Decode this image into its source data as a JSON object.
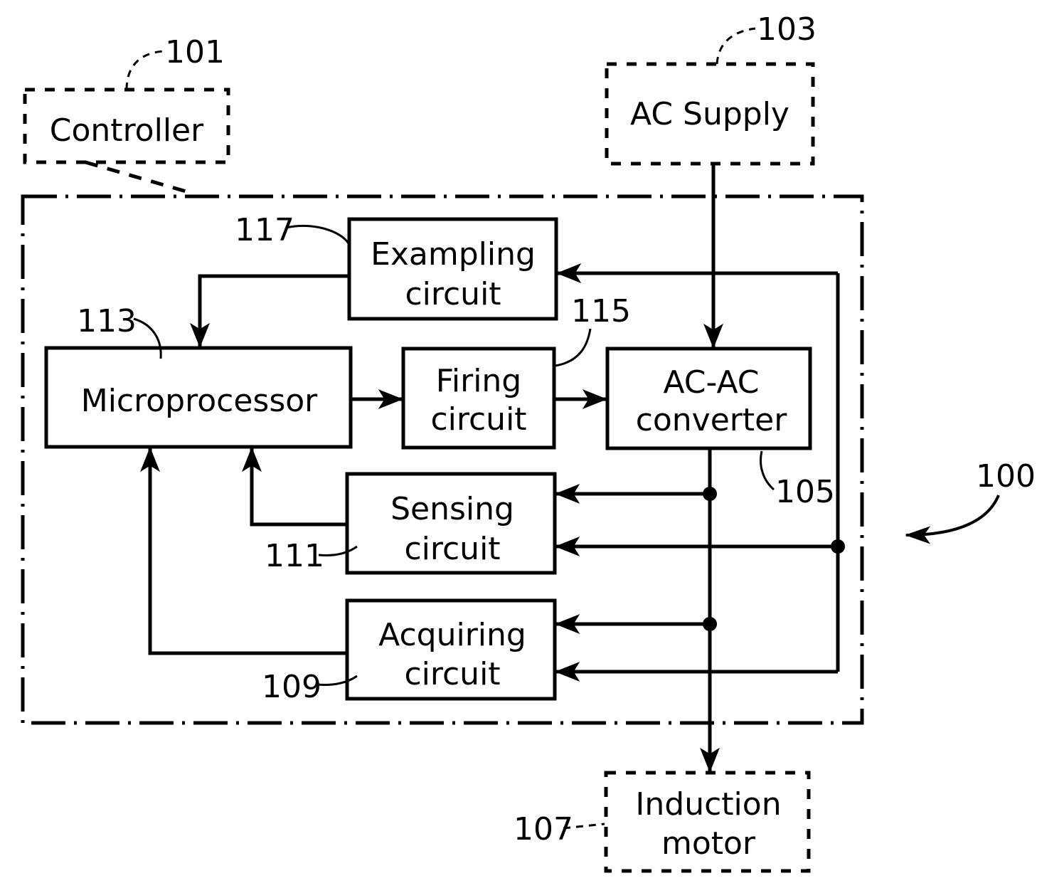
{
  "figure": {
    "system_ref": "100",
    "external_blocks": {
      "controller": {
        "lines": [
          "Controller"
        ],
        "ref": "101"
      },
      "ac_supply": {
        "lines": [
          "AC Supply"
        ],
        "ref": "103"
      },
      "induction_motor": {
        "lines": [
          "Induction",
          "motor"
        ],
        "ref": "107"
      }
    },
    "blocks": {
      "exampling": {
        "lines": [
          "Exampling",
          "circuit"
        ],
        "ref": "117"
      },
      "microprocessor": {
        "lines": [
          "Microprocessor"
        ],
        "ref": "113"
      },
      "firing": {
        "lines": [
          "Firing",
          "circuit"
        ],
        "ref": "115"
      },
      "converter": {
        "lines": [
          "AC-AC",
          "converter"
        ],
        "ref": "105"
      },
      "sensing": {
        "lines": [
          "Sensing",
          "circuit"
        ],
        "ref": "111"
      },
      "acquiring": {
        "lines": [
          "Acquiring",
          "circuit"
        ],
        "ref": "109"
      }
    }
  }
}
